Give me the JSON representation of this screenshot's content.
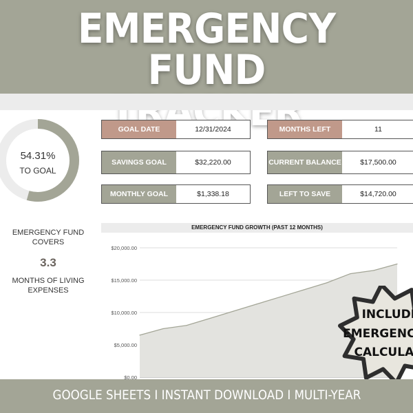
{
  "banner": {
    "title_line1": "EMERGENCY FUND",
    "title_line2": "TRACKER"
  },
  "progress": {
    "percent_text": "54.31%",
    "label": "TO GOAL",
    "fraction": 0.5431
  },
  "cards": {
    "goal_date": {
      "label": "GOAL DATE",
      "value": "12/31/2024"
    },
    "savings_goal": {
      "label": "SAVINGS GOAL",
      "value": "$32,220.00"
    },
    "monthly_goal": {
      "label": "MONTHLY GOAL",
      "value": "$1,338.18"
    },
    "months_left": {
      "label": "MONTHS LEFT",
      "value": "11"
    },
    "current_balance": {
      "label": "CURRENT BALANCE",
      "value": "$17,500.00"
    },
    "left_to_save": {
      "label": "LEFT TO SAVE",
      "value": "$14,720.00"
    }
  },
  "covers": {
    "line1": "EMERGENCY FUND",
    "line2": "COVERS",
    "value": "3.3",
    "line3": "MONTHS OF LIVING",
    "line4": "EXPENSES"
  },
  "badge": {
    "line1": "INCLUDE",
    "line2": "EMERGENCY",
    "line3": "CALCULAT"
  },
  "footer": {
    "text": "GOOGLE SHEETS I INSTANT DOWNLOAD I MULTI-YEAR"
  },
  "colors": {
    "sage": "#a3a596",
    "rose": "#c0998a",
    "area_fill": "#e3e3df",
    "line": "#a3a596"
  },
  "chart_data": {
    "type": "area",
    "title": "EMERGENCY FUND GROWTH (PAST 12 MONTHS)",
    "xlabel": "",
    "ylabel": "",
    "x": [
      1,
      2,
      3,
      4,
      5,
      6,
      7,
      8,
      9,
      10,
      11,
      12
    ],
    "values": [
      6500,
      7500,
      8000,
      9100,
      10200,
      11300,
      12400,
      13500,
      14600,
      16000,
      16500,
      17500
    ],
    "ylim": [
      0,
      20000
    ],
    "yticks": [
      0,
      5000,
      10000,
      15000,
      20000
    ],
    "ytick_labels": [
      "$0.00",
      "$5,000.00",
      "$10,000.00",
      "$15,000.00",
      "$20,000.00"
    ],
    "grid": true,
    "legend": "none"
  }
}
